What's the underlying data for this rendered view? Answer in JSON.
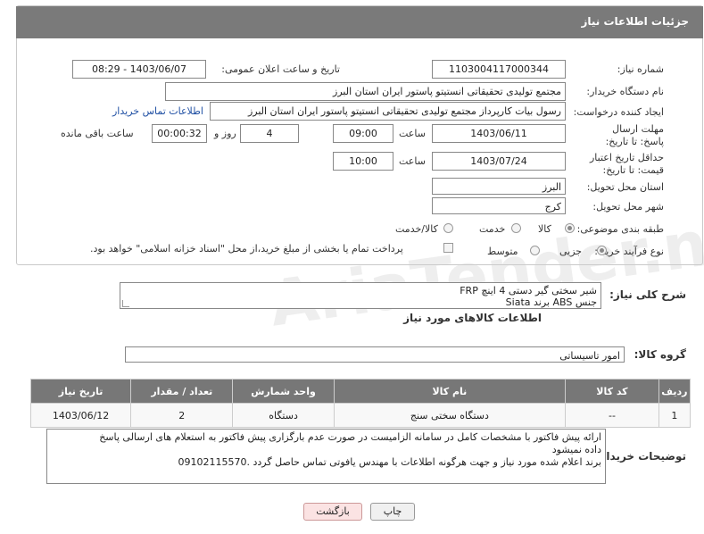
{
  "header": {
    "title": "جزئیات اطلاعات نیاز"
  },
  "form": {
    "need_number_label": "شماره نیاز:",
    "need_number": "1103004117000344",
    "announce_label": "تاریخ و ساعت اعلان عمومی:",
    "announce_value": "1403/06/07 - 08:29",
    "buyer_label": "نام دستگاه خریدار:",
    "buyer_value": "مجتمع تولیدی تحقیقاتی انستیتو پاستور ایران استان البرز",
    "creator_label": "ایجاد کننده درخواست:",
    "creator_value": "رسول بیات کارپرداز مجتمع تولیدی تحقیقاتی انستیتو پاستور ایران استان البرز",
    "contact_link": "اطلاعات تماس خریدار",
    "deadline_label": "مهلت ارسال پاسخ: تا تاریخ:",
    "deadline_date": "1403/06/11",
    "time_label": "ساعت",
    "deadline_time": "09:00",
    "days_value": "4",
    "days_label": "روز و",
    "remaining_time": "00:00:32",
    "remaining_label": "ساعت باقی مانده",
    "validity_label": "حداقل تاریخ اعتبار قیمت: تا تاریخ:",
    "validity_date": "1403/07/24",
    "validity_time": "10:00",
    "province_label": "استان محل تحویل:",
    "province_value": "البرز",
    "city_label": "شهر محل تحویل:",
    "city_value": "کرج",
    "category_label": "طبقه بندی موضوعی:",
    "category_options": [
      "کالا",
      "خدمت",
      "کالا/خدمت"
    ],
    "process_label": "نوع فرآیند خرید :",
    "process_options": [
      "جزیی",
      "متوسط"
    ],
    "payment_note": "پرداخت تمام یا بخشی از مبلغ خرید،از محل \"اسناد خزانه اسلامی\" خواهد بود."
  },
  "summary": {
    "label": "شرح کلی نیاز:",
    "line1": "شیر سختی گیر دستی 4 اینچ  FRP",
    "line2": "جنس ABS برند Siata"
  },
  "goods_info_title": "اطلاعات کالاهای مورد نیاز",
  "goods_group": {
    "label": "گروه کالا:",
    "value": "امور تاسیساتی"
  },
  "table": {
    "headers": [
      "ردیف",
      "کد کالا",
      "نام کالا",
      "واحد شمارش",
      "تعداد / مقدار",
      "تاریخ نیاز"
    ],
    "rows": [
      [
        "1",
        "--",
        "دستگاه سختی سنج",
        "دستگاه",
        "2",
        "1403/06/12"
      ]
    ]
  },
  "buyer_notes": {
    "label": "توضیحات خریدار:",
    "line1": "ارائه پیش فاکتور با مشخصات کامل در سامانه الزامیست در صورت عدم بارگزاری پیش فاکتور به استعلام های ارسالی پاسخ",
    "line2": "داده نمیشود",
    "line3": "برند اعلام شده مورد نیاز و جهت هرگونه اطلاعات با مهندس یافوتی تماس حاصل گردد .09102115570"
  },
  "buttons": {
    "print": "چاپ",
    "back": "بازگشت"
  },
  "watermark": "AriaTender.net",
  "colors": {
    "header_bg": "#7a7a7a",
    "link": "#1f4fa3",
    "back_btn_bg": "#fbe3e3"
  }
}
